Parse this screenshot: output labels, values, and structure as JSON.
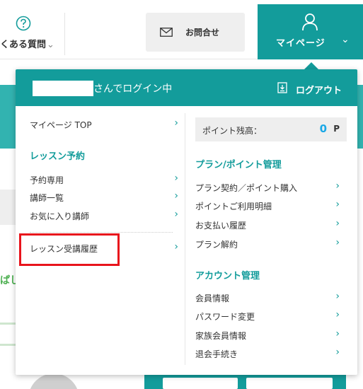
{
  "header": {
    "faq_label": "くある質問",
    "contact_label": "お問合せ",
    "mypage_label": "マイページ"
  },
  "background": {
    "green_text": "ぱし"
  },
  "panel": {
    "login_status": "さんでログイン中",
    "logout_label": "ログアウト",
    "left": {
      "top_link": "マイページ TOP",
      "lesson_section": "レッスン予約",
      "items": [
        "予約専用",
        "講師一覧",
        "お気に入り講師"
      ],
      "history_link": "レッスン受講履歴"
    },
    "right": {
      "points_label": "ポイント残高：",
      "points_value": "0",
      "points_unit": "P",
      "plan_section": "プラン/ポイント管理",
      "plan_items": [
        "プラン契約／ポイント購入",
        "ポイントご利用明細",
        "お支払い履歴",
        "プラン解約"
      ],
      "account_section": "アカウント管理",
      "account_items": [
        "会員情報",
        "パスワード変更",
        "家族会員情報",
        "退会手続き"
      ]
    }
  },
  "colors": {
    "brand_teal": "#139c9b",
    "highlight_red": "#e8141c",
    "points_blue": "#1aa8e6"
  },
  "icons": {
    "faq": "question-circle-icon",
    "contact": "envelope-icon",
    "mypage": "user-icon",
    "logout": "logout-icon",
    "menu_arrow": "chevron-right-icon"
  }
}
